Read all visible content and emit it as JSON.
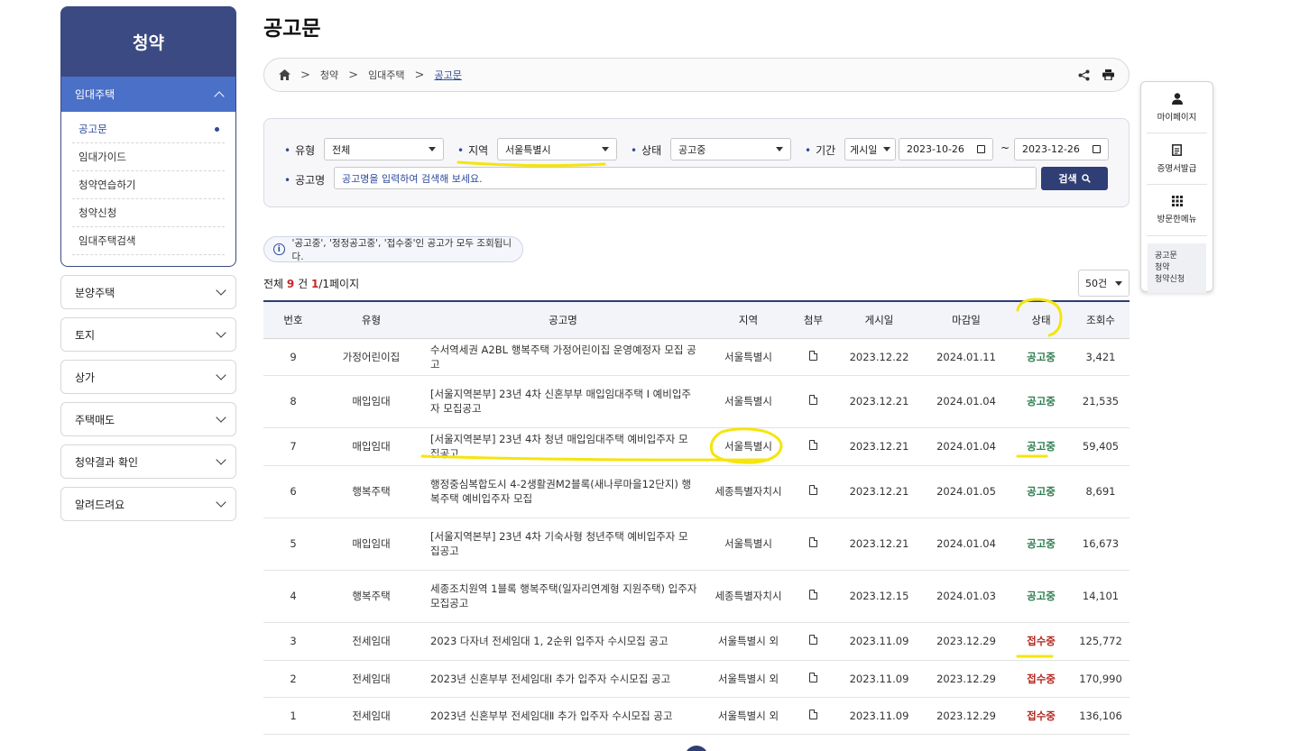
{
  "sidebar": {
    "title": "청약",
    "open_section": "임대주택",
    "sub_items": [
      {
        "label": "공고문",
        "active": true
      },
      {
        "label": "임대가이드"
      },
      {
        "label": "청약연습하기"
      },
      {
        "label": "청약신청"
      },
      {
        "label": "임대주택검색"
      }
    ],
    "sections": [
      "분양주택",
      "토지",
      "상가",
      "주택매도",
      "청약결과 확인",
      "알려드려요"
    ]
  },
  "page": {
    "title": "공고문",
    "breadcrumb": [
      "청약",
      "임대주택",
      "공고문"
    ]
  },
  "search": {
    "type_label": "유형",
    "type_value": "전체",
    "region_label": "지역",
    "region_value": "서울특별시",
    "status_label": "상태",
    "status_value": "공고중",
    "period_label": "기간",
    "period_type": "게시일",
    "date_from": "2023-10-26",
    "date_to": "2023-12-26",
    "tilde": "~",
    "name_label": "공고명",
    "name_placeholder": "공고명을 입력하여 검색해 보세요.",
    "button": "검색"
  },
  "notice": "'공고중', '정정공고중', '접수중'인 공고가 모두 조회됩니다.",
  "summary": {
    "prefix": "전체",
    "count": "9",
    "unit": "건",
    "page_current": "1",
    "page_rest": "/1페이지",
    "per_page": "50건"
  },
  "table": {
    "headers": [
      "번호",
      "유형",
      "공고명",
      "지역",
      "첨부",
      "게시일",
      "마감일",
      "상태",
      "조회수"
    ],
    "rows": [
      {
        "no": "9",
        "type": "가정어린이집",
        "title": "수서역세권 A2BL 행복주택 가정어린이집 운영예정자 모집 공고",
        "region": "서울특별시",
        "posted": "2023.12.22",
        "deadline": "2024.01.11",
        "status": "공고중",
        "views": "3,421"
      },
      {
        "no": "8",
        "type": "매입임대",
        "title": "[서울지역본부] 23년 4차 신혼부부 매입임대주택 Ⅰ 예비입주자 모집공고",
        "region": "서울특별시",
        "posted": "2023.12.21",
        "deadline": "2024.01.04",
        "status": "공고중",
        "views": "21,535"
      },
      {
        "no": "7",
        "type": "매입임대",
        "title": "[서울지역본부] 23년 4차 청년 매입임대주택 예비입주자 모집공고",
        "region": "서울특별시",
        "posted": "2023.12.21",
        "deadline": "2024.01.04",
        "status": "공고중",
        "views": "59,405"
      },
      {
        "no": "6",
        "type": "행복주택",
        "title": "행정중심복합도시 4-2생활권M2블록(새나루마을12단지) 행복주택 예비입주자 모집",
        "region": "세종특별자치시",
        "posted": "2023.12.21",
        "deadline": "2024.01.05",
        "status": "공고중",
        "views": "8,691"
      },
      {
        "no": "5",
        "type": "매입임대",
        "title": "[서울지역본부] 23년 4차 기숙사형 청년주택 예비입주자 모집공고",
        "region": "서울특별시",
        "posted": "2023.12.21",
        "deadline": "2024.01.04",
        "status": "공고중",
        "views": "16,673"
      },
      {
        "no": "4",
        "type": "행복주택",
        "title": "세종조치원역 1블록 행복주택(일자리연계형 지원주택) 입주자모집공고",
        "region": "세종특별자치시",
        "posted": "2023.12.15",
        "deadline": "2024.01.03",
        "status": "공고중",
        "views": "14,101"
      },
      {
        "no": "3",
        "type": "전세임대",
        "title": "2023 다자녀 전세임대 1, 2순위 입주자 수시모집 공고",
        "region": "서울특별시 외",
        "posted": "2023.11.09",
        "deadline": "2023.12.29",
        "status": "접수중",
        "views": "125,772"
      },
      {
        "no": "2",
        "type": "전세임대",
        "title": "2023년 신혼부부 전세임대Ⅰ 추가 입주자 수시모집 공고",
        "region": "서울특별시 외",
        "posted": "2023.11.09",
        "deadline": "2023.12.29",
        "status": "접수중",
        "views": "170,990"
      },
      {
        "no": "1",
        "type": "전세임대",
        "title": "2023년 신혼부부 전세임대Ⅱ 추가 입주자 수시모집 공고",
        "region": "서울특별시 외",
        "posted": "2023.11.09",
        "deadline": "2023.12.29",
        "status": "접수중",
        "views": "136,106"
      }
    ]
  },
  "quick_menu": {
    "items": [
      "마이페이지",
      "증명서발급",
      "방문한메뉴"
    ],
    "recent": [
      "공고문",
      "청약",
      "청약신청"
    ]
  },
  "colors": {
    "nav_dark": "#3b4a82",
    "nav_active": "#4a70c8",
    "status_open": "#2e7d4f",
    "status_receiving": "#b3261e",
    "highlight_marks": "#f5e50a"
  }
}
